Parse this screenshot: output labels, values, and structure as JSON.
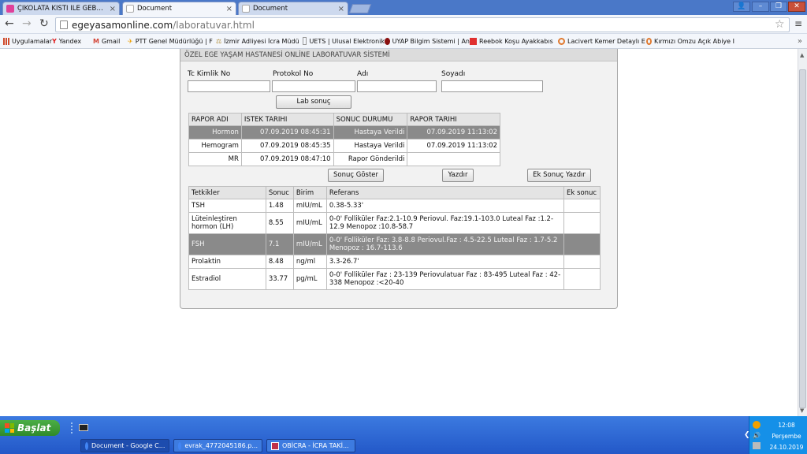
{
  "browser": {
    "tabs": [
      {
        "title": "ÇİKOLATA KİSTİ İLE GEBE K",
        "active": false,
        "favicon_color": "#e0409a"
      },
      {
        "title": "Document",
        "active": true,
        "favicon_color": "#cccccc"
      },
      {
        "title": "Document",
        "active": false,
        "favicon_color": "#cccccc"
      }
    ],
    "url_host": "egeyasamonline.com",
    "url_path": "/laboratuvar.html",
    "bookmarks": [
      {
        "label": "Uygulamalar",
        "icon": "apps-grid-icon",
        "color": "#d04b2c"
      },
      {
        "label": "Yandex",
        "icon": "yandex-icon",
        "color": "#e02020"
      },
      {
        "label": "Gmail",
        "icon": "gmail-icon",
        "color": "#d44638"
      },
      {
        "label": "PTT Genel Müdürlüğü | F",
        "icon": "ptt-icon",
        "color": "#f0a000"
      },
      {
        "label": "İzmir Adliyesi İcra Müdü",
        "icon": "adliye-icon",
        "color": "#b08a30"
      },
      {
        "label": "UETS | Ulusal Elektronik",
        "icon": "document-icon",
        "color": "#999999"
      },
      {
        "label": "UYAP Bilgim Sistemi | An",
        "icon": "uyap-icon",
        "color": "#8a1010"
      },
      {
        "label": "Reebok Koşu Ayakkabıs",
        "icon": "reebok-icon",
        "color": "#e03030"
      },
      {
        "label": "Lacivert Kemer Detaylı E",
        "icon": "shop-icon",
        "color": "#e07a30"
      },
      {
        "label": "Kırmızı Omzu Açık Abiye I",
        "icon": "shop-icon",
        "color": "#e07a30"
      }
    ]
  },
  "panel": {
    "header": "ÖZEL EGE YAŞAM HASTANESİ ONLİNE LABORATUVAR SİSTEMİ",
    "labels": {
      "tc": "Tc Kimlik No",
      "protokol": "Protokol No",
      "adi": "Adı",
      "soyadi": "Soyadı"
    },
    "inputs": {
      "tc": "",
      "protokol": "",
      "adi": "",
      "soyadi": ""
    },
    "lab_button": "Lab sonuç",
    "report_columns": [
      "RAPOR ADI",
      "ISTEK TARIHI",
      "SONUC DURUMU",
      "RAPOR TARIHI"
    ],
    "reports": [
      {
        "name": "Hormon",
        "request": "07.09.2019 08:45:31",
        "status": "Hastaya Verildi",
        "date": "07.09.2019 11:13:02",
        "selected": true
      },
      {
        "name": "Hemogram",
        "request": "07.09.2019 08:45:35",
        "status": "Hastaya Verildi",
        "date": "07.09.2019 11:13:02",
        "selected": false
      },
      {
        "name": "MR",
        "request": "07.09.2019 08:47:10",
        "status": "Rapor Gönderildi",
        "date": "",
        "selected": false
      }
    ],
    "buttons": {
      "show": "Sonuç Göster",
      "print": "Yazdır",
      "extra_print": "Ek Sonuç Yazdır"
    },
    "result_columns": [
      "Tetkikler",
      "Sonuc",
      "Birim",
      "Referans",
      "Ek sonuc"
    ],
    "results": [
      {
        "test": "TSH",
        "value": "1.48",
        "unit": "mIU/mL",
        "ref": "0.38-5.33'",
        "extra": "",
        "selected": false
      },
      {
        "test": "Lüteinleştiren hormon (LH)",
        "value": "8.55",
        "unit": "mIU/mL",
        "ref": "0-0' Folliküler Faz:2.1-10.9 Periovul. Faz:19.1-103.0 Luteal Faz :1.2-12.9 Menopoz :10.8-58.7",
        "extra": "",
        "selected": false
      },
      {
        "test": "FSH",
        "value": "7.1",
        "unit": "mIU/mL",
        "ref": "0-0' Folliküler Faz: 3.8-8.8 Periovul.Faz : 4.5-22.5 Luteal Faz : 1.7-5.2 Menopoz : 16.7-113.6",
        "extra": "",
        "selected": true
      },
      {
        "test": "Prolaktin",
        "value": "8.48",
        "unit": "ng/ml",
        "ref": "3.3-26.7'",
        "extra": "",
        "selected": false
      },
      {
        "test": "Estradiol",
        "value": "33.77",
        "unit": "pg/mL",
        "ref": "0-0' Folliküler Faz : 23-139 Periovulatuar Faz : 83-495 Luteal Faz : 42-338 Menopoz :<20-40",
        "extra": "",
        "selected": false
      }
    ]
  },
  "taskbar": {
    "start": "Başlat",
    "tasks": [
      {
        "label": "Document - Google C...",
        "active": true,
        "icon": "chrome-icon"
      },
      {
        "label": "evrak_4772045186.p...",
        "active": false,
        "icon": "chrome-icon"
      },
      {
        "label": "OBİCRA - İCRA TAKİ...",
        "active": false,
        "icon": "app-icon"
      }
    ],
    "time": "12:08",
    "day": "Perşembe",
    "date": "24.10.2019"
  }
}
